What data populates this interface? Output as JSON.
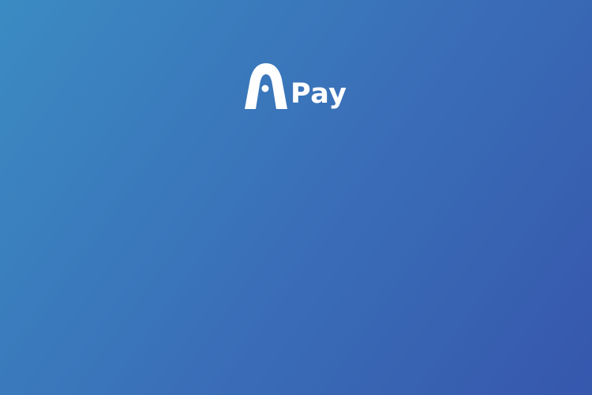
{
  "brand": {
    "mark_icon": "arch-a-logo-icon",
    "wordmark": "Pay",
    "text_color": "#ffffff"
  },
  "background": {
    "gradient_start": "#3b8bc3",
    "gradient_end": "#3657ad"
  }
}
